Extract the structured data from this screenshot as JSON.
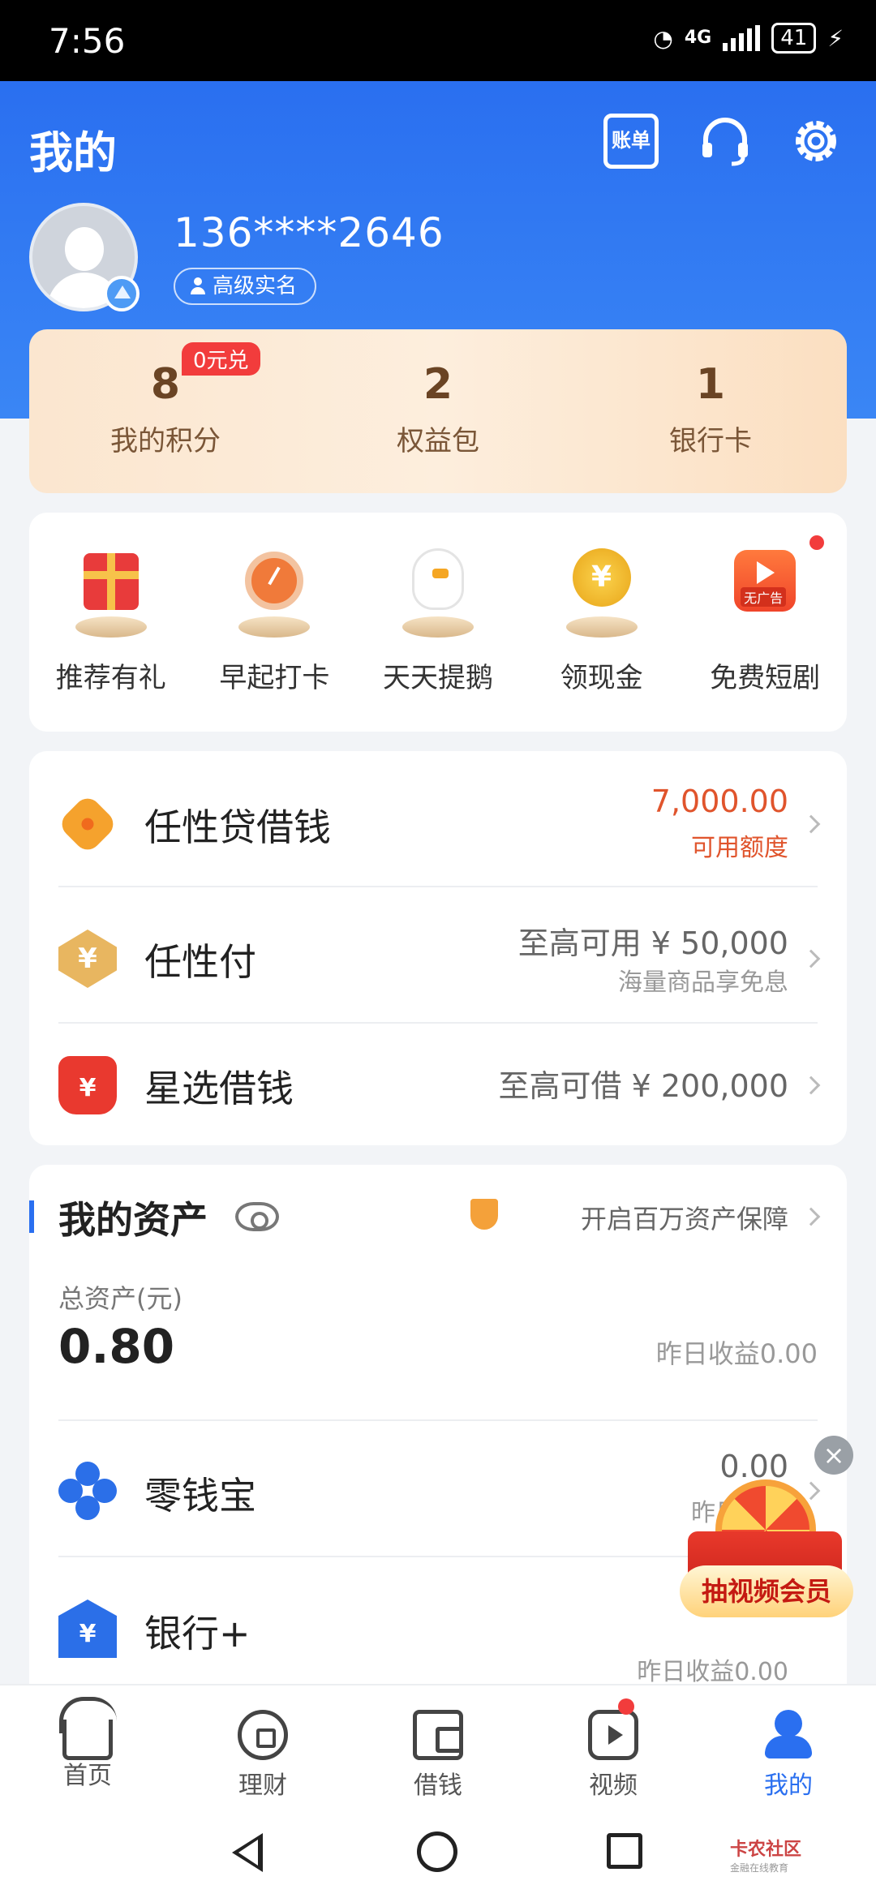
{
  "status_bar": {
    "time": "7:56",
    "network": "4G",
    "battery": "41"
  },
  "header": {
    "title": "我的",
    "bill_label": "账单",
    "phone": "136****2646",
    "verify_label": "高级实名"
  },
  "points": [
    {
      "value": "8",
      "label": "我的积分"
    },
    {
      "value": "2",
      "label": "权益包"
    },
    {
      "value": "1",
      "label": "银行卡"
    }
  ],
  "redeem_badge": "0元兑",
  "quick_actions": [
    {
      "label": "推荐有礼"
    },
    {
      "label": "早起打卡"
    },
    {
      "label": "天天提鹅"
    },
    {
      "label": "领现金"
    },
    {
      "label": "免费短剧",
      "badge": "无广告"
    }
  ],
  "loans": [
    {
      "title": "任性贷借钱",
      "line1": "7,000.00",
      "line2": "可用额度"
    },
    {
      "title": "任性付",
      "line1": "至高可用 ¥ 50,000",
      "line2": "海量商品享免息"
    },
    {
      "title": "星选借钱",
      "line1": "至高可借 ¥ 200,000"
    }
  ],
  "assets": {
    "title": "我的资产",
    "protect": "开启百万资产保障",
    "total_label": "总资产(元)",
    "total_value": "0.80",
    "yesterday": "昨日收益0.00",
    "items": [
      {
        "title": "零钱宝",
        "value": "0.00",
        "sub": "昨日收益"
      },
      {
        "title": "银行+",
        "sub": "昨日收益0.00"
      }
    ]
  },
  "promo": {
    "label": "抽视频会员",
    "close": "×"
  },
  "bottom_nav": [
    {
      "label": "首页"
    },
    {
      "label": "理财"
    },
    {
      "label": "借钱"
    },
    {
      "label": "视频"
    },
    {
      "label": "我的"
    }
  ],
  "watermark": {
    "name": "卡农社区",
    "sub": "金融在线教育"
  },
  "colors": {
    "primary": "#2a6ff0",
    "accent_red": "#f23c3c",
    "amount_red": "#e0542c",
    "card_gold": "#fbe6cf"
  },
  "icons": {
    "header": [
      "bill-icon",
      "headset-icon",
      "gear-icon"
    ],
    "loans": [
      "renxingdai-icon",
      "renxingfu-icon",
      "xingxuan-icon"
    ],
    "assets": [
      "eye-icon",
      "shield-icon",
      "lingqianbao-icon",
      "bank-icon"
    ]
  }
}
